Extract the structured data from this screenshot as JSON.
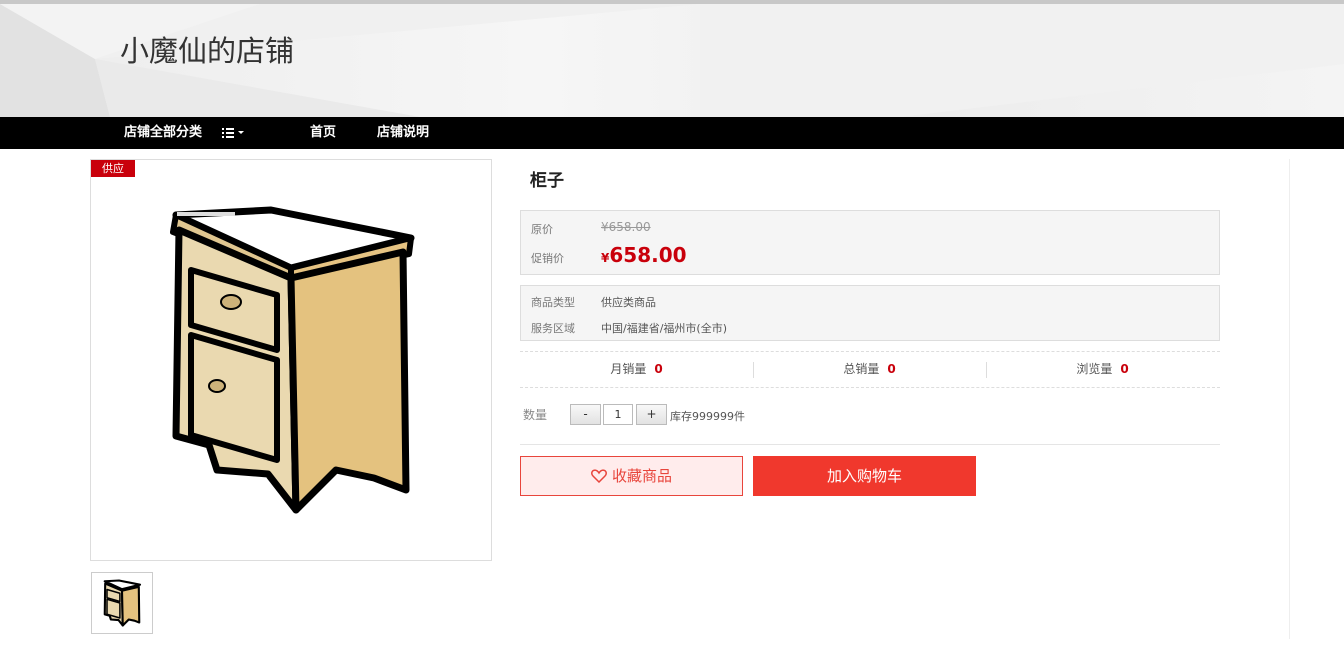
{
  "shop": {
    "title": "小魔仙的店铺"
  },
  "nav": {
    "all_categories": "店铺全部分类",
    "home": "首页",
    "shop_info": "店铺说明"
  },
  "product": {
    "tag": "供应",
    "name": "柜子",
    "original_price_label": "原价",
    "original_price": "¥658.00",
    "promo_price_label": "促销价",
    "promo_currency": "¥",
    "promo_price": "658.00",
    "type_label": "商品类型",
    "type_value": "供应类商品",
    "area_label": "服务区域",
    "area_value": "中国/福建省/福州市(全市)"
  },
  "stats": {
    "monthly_label": "月销量",
    "monthly_value": "0",
    "total_label": "总销量",
    "total_value": "0",
    "views_label": "浏览量",
    "views_value": "0"
  },
  "quantity": {
    "label": "数量",
    "minus": "-",
    "value": "1",
    "plus": "+",
    "stock": "库存999999件"
  },
  "actions": {
    "favorite": "收藏商品",
    "add_to_cart": "加入购物车"
  },
  "colors": {
    "accent_red": "#c9000b",
    "cart_button": "#f0382d",
    "nav_bg": "#000000"
  }
}
